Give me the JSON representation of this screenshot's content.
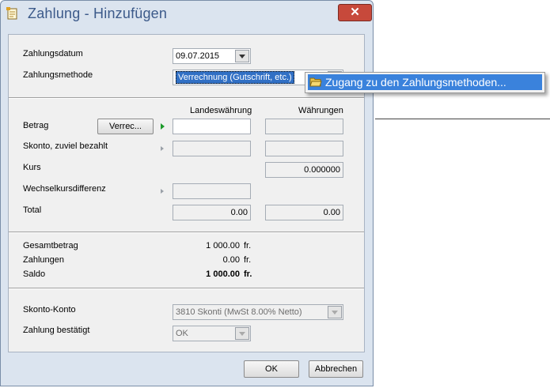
{
  "window": {
    "title": "Zahlung - Hinzufügen",
    "close_label": "✕"
  },
  "top": {
    "date_label": "Zahlungsdatum",
    "date_value": "09.07.2015",
    "method_label": "Zahlungsmethode",
    "method_value": "Verrechnung (Gutschrift, etc.)"
  },
  "popup": {
    "item_label": "Zugang zu den Zahlungsmethoden..."
  },
  "amounts": {
    "col_local": "Landeswährung",
    "col_foreign": "Währungen",
    "betrag_label": "Betrag",
    "verrec_button": "Verrec...",
    "skonto_label": "Skonto, zuviel bezahlt",
    "kurs_label": "Kurs",
    "kurs_value": "0.000000",
    "wechsel_label": "Wechselkursdifferenz",
    "total_label": "Total",
    "total_local": "0.00",
    "total_foreign": "0.00"
  },
  "summary": {
    "gesamt_label": "Gesamtbetrag",
    "gesamt_value": "1 000.00",
    "gesamt_unit": "fr.",
    "zahlungen_label": "Zahlungen",
    "zahlungen_value": "0.00",
    "zahlungen_unit": "fr.",
    "saldo_label": "Saldo",
    "saldo_value": "1 000.00",
    "saldo_unit": "fr."
  },
  "bottom": {
    "skonto_konto_label": "Skonto-Konto",
    "skonto_konto_value": "3810 Skonti (MwSt 8.00% Netto)",
    "bestaetigt_label": "Zahlung bestätigt",
    "bestaetigt_value": "OK"
  },
  "buttons": {
    "ok": "OK",
    "cancel": "Abbrechen"
  },
  "colors": {
    "titlebar": "#dbe4ef",
    "close": "#c7493b",
    "highlight": "#3a82dc"
  }
}
